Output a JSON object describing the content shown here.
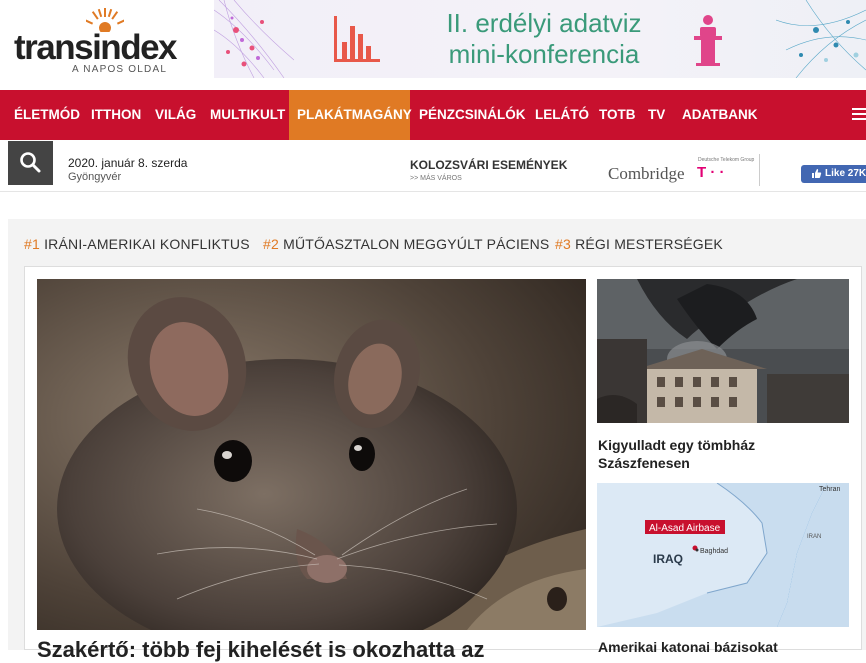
{
  "logo": {
    "name": "transindex",
    "tagline": "A NAPOS OLDAL"
  },
  "banner": {
    "line1": "II. erdélyi adatviz",
    "line2": "mini-konferencia"
  },
  "nav": {
    "items": [
      "ÉLETMÓD",
      "ITTHON",
      "VILÁG",
      "MULTIKULT",
      "PLAKÁTMAGÁNY",
      "PÉNZCSINÁLÓK",
      "LELÁTÓ",
      "TOTB",
      "TV",
      "ADATBANK"
    ],
    "active": "PLAKÁTMAGÁNY"
  },
  "subbar": {
    "date": "2020. január 8. szerda",
    "nameday": "Gyöngyvér",
    "events": "KOLOZSVÁRI ESEMÉNYEK",
    "events_sub": ">> MÁS VÁROS",
    "sponsor_name": "Combridge",
    "sponsor_small": "Deutsche Telekom Group",
    "sponsor_mark": "T · ·",
    "like_label": "Like 27K"
  },
  "trending": [
    {
      "num": "#1",
      "label": "IRÁNI-AMERIKAI KONFLIKTUS"
    },
    {
      "num": "#2",
      "label": "MŰTŐASZTALON MEGGYÚLT PÁCIENS"
    },
    {
      "num": "#3",
      "label": "RÉGI MESTERSÉGEK"
    }
  ],
  "main_article": {
    "title": "Szakértő: több fej kihelését is okozhatta az"
  },
  "side_articles": [
    {
      "title": "Kigyulladt egy tömbház Szászfenesen"
    },
    {
      "title": "Amerikai katonai bázisokat"
    }
  ],
  "map_labels": {
    "airbase": "Al-Asad Airbase",
    "country": "IRAQ",
    "city": "Baghdad",
    "tehran": "Tehran",
    "iran": "IRAN"
  },
  "colors": {
    "nav_bg": "#c8102e",
    "active_bg": "#e07a24",
    "accent": "#e07a24"
  }
}
